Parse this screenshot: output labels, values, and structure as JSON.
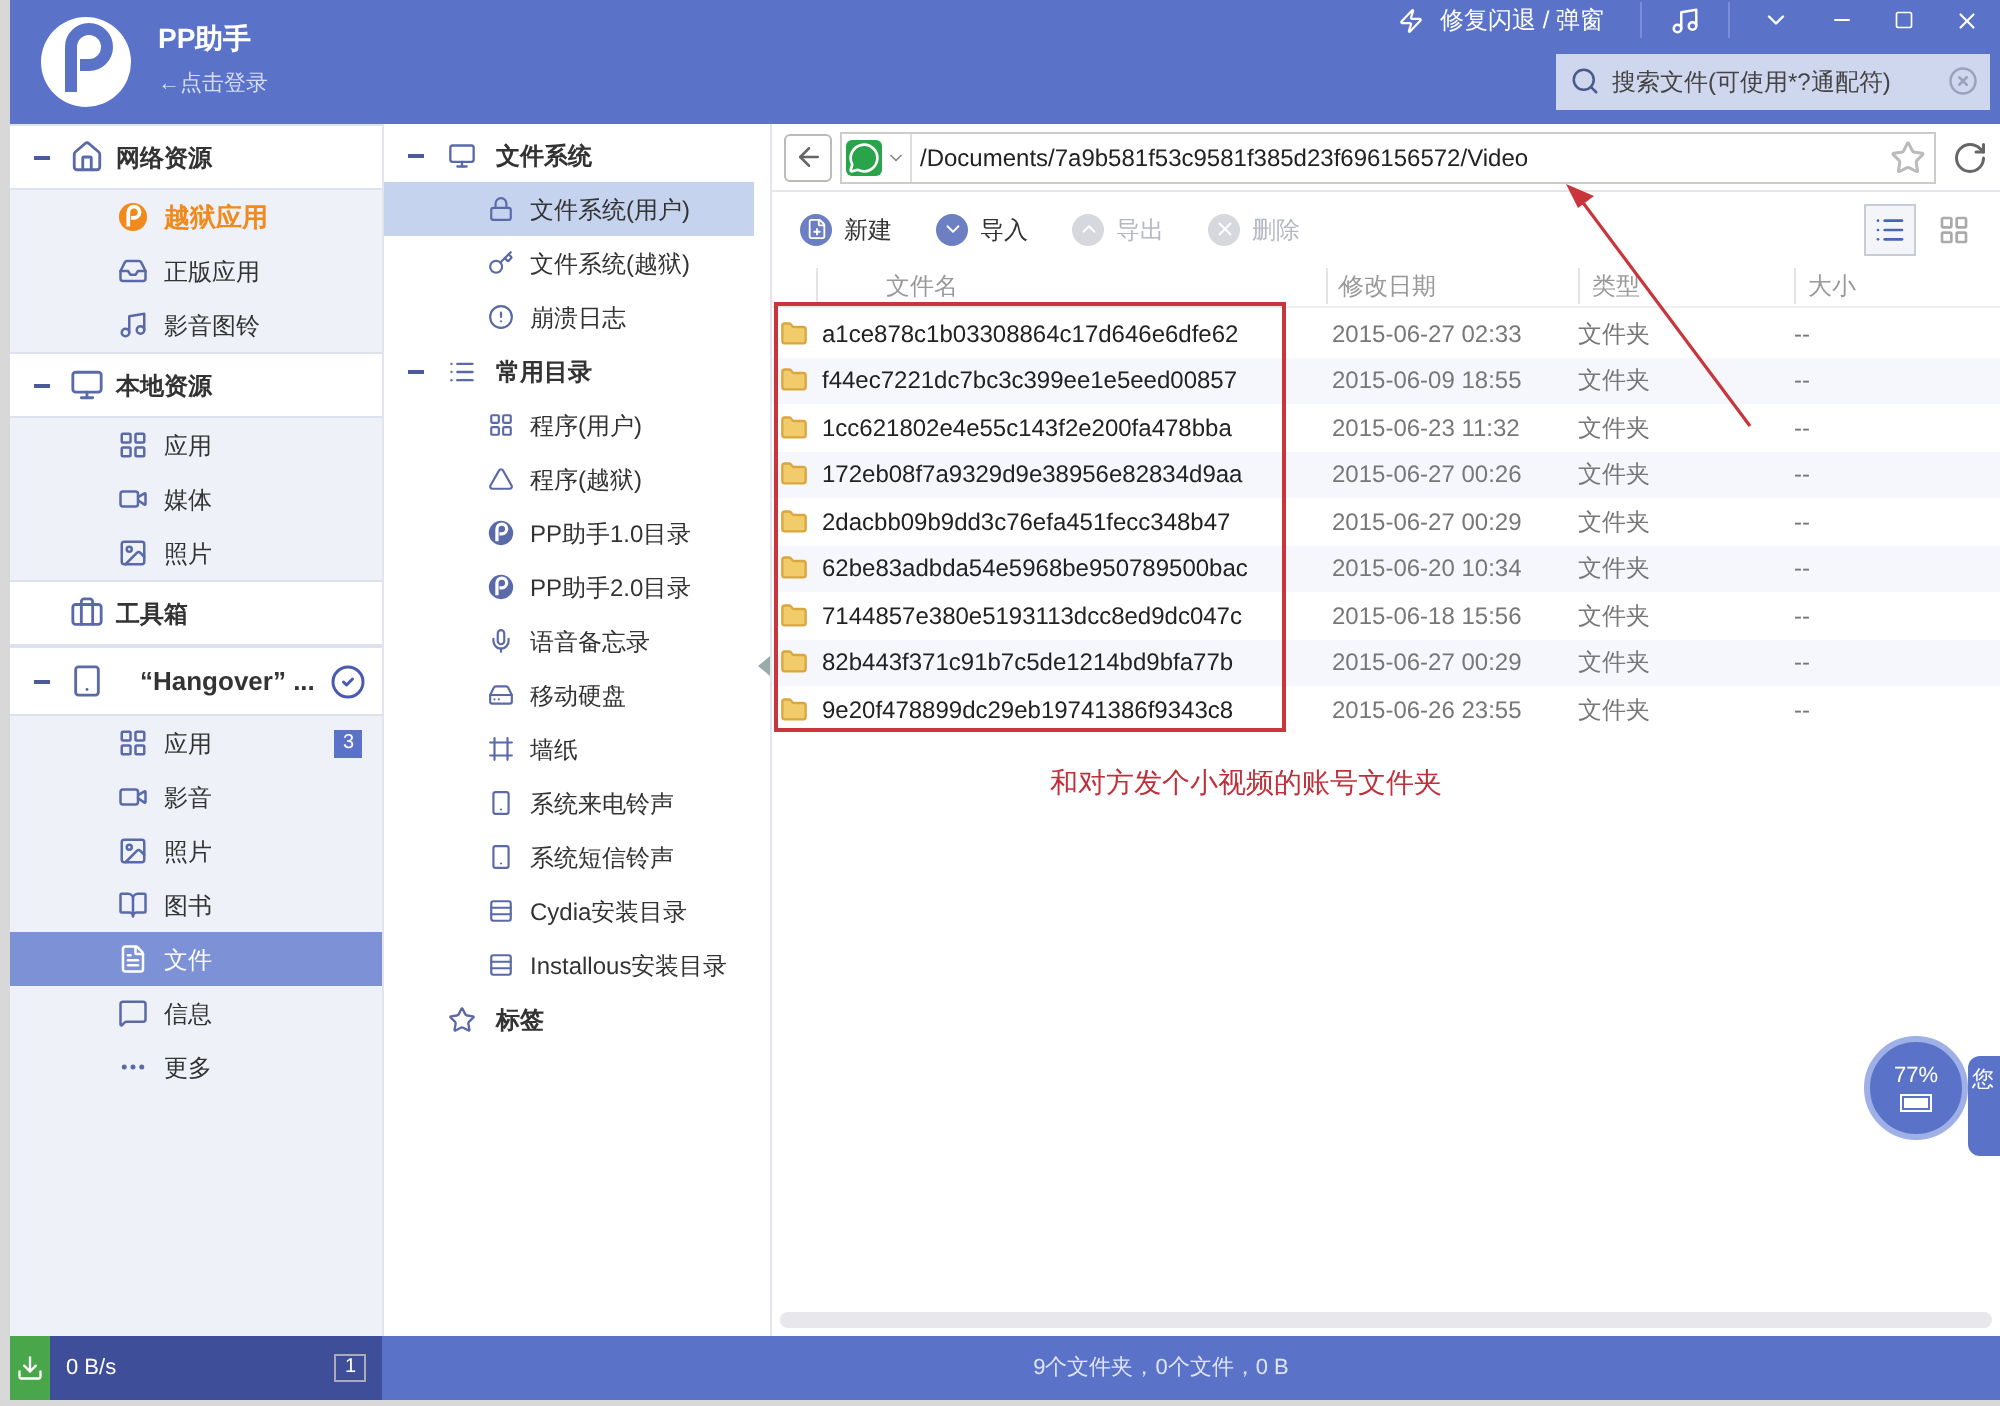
{
  "app": {
    "name": "PP助手",
    "login": "←点击登录",
    "fix_link": "修复闪退 / 弹窗",
    "search": {
      "placeholder": "搜索文件(可使用*?通配符)"
    }
  },
  "sidebar": {
    "groups": [
      {
        "label": "网络资源",
        "expanded": true,
        "children": [
          {
            "label": "越狱应用",
            "highlighted": true,
            "selected": false
          },
          {
            "label": "正版应用",
            "highlighted": false,
            "selected": false
          },
          {
            "label": "影音图铃",
            "highlighted": false,
            "selected": false
          }
        ]
      },
      {
        "label": "本地资源",
        "expanded": true,
        "children": [
          {
            "label": "应用",
            "selected": false
          },
          {
            "label": "媒体",
            "selected": false
          },
          {
            "label": "照片",
            "selected": false
          }
        ]
      },
      {
        "label": "工具箱"
      },
      {
        "label": "“Hangover” ...",
        "expanded": true,
        "connected": true,
        "children": [
          {
            "label": "应用",
            "count": "3",
            "selected": false
          },
          {
            "label": "影音",
            "selected": false
          },
          {
            "label": "照片",
            "selected": false
          },
          {
            "label": "图书",
            "selected": false
          },
          {
            "label": "文件",
            "selected": true
          },
          {
            "label": "信息",
            "selected": false
          },
          {
            "label": "更多",
            "selected": false
          }
        ]
      }
    ]
  },
  "tree": {
    "groups": [
      {
        "label": "文件系统",
        "expanded": true,
        "children": [
          {
            "label": "文件系统(用户)",
            "selected": true
          },
          {
            "label": "文件系统(越狱)",
            "selected": false
          },
          {
            "label": "崩溃日志",
            "selected": false
          }
        ]
      },
      {
        "label": "常用目录",
        "expanded": true,
        "children": [
          {
            "label": "程序(用户)",
            "selected": false
          },
          {
            "label": "程序(越狱)",
            "selected": false
          },
          {
            "label": "PP助手1.0目录",
            "selected": false
          },
          {
            "label": "PP助手2.0目录",
            "selected": false
          },
          {
            "label": "语音备忘录",
            "selected": false
          },
          {
            "label": "移动硬盘",
            "selected": false
          },
          {
            "label": "墙纸",
            "selected": false
          },
          {
            "label": "系统来电铃声",
            "selected": false
          },
          {
            "label": "系统短信铃声",
            "selected": false
          },
          {
            "label": "Cydia安装目录",
            "selected": false
          },
          {
            "label": "Installous安装目录",
            "selected": false
          }
        ]
      },
      {
        "label": "标签"
      }
    ]
  },
  "path": "/Documents/7a9b581f53c9581f385d23f696156572/Video",
  "toolbar": [
    {
      "label": "新建",
      "disabled": false
    },
    {
      "label": "导入",
      "disabled": false
    },
    {
      "label": "导出",
      "disabled": true
    },
    {
      "label": "删除",
      "disabled": true
    }
  ],
  "views": [
    {
      "kind": "list",
      "selected": true
    },
    {
      "kind": "grid",
      "selected": false
    }
  ],
  "table": {
    "columns": [
      "文件名",
      "修改日期",
      "类型",
      "大小"
    ],
    "rows": [
      [
        "a1ce878c1b03308864c17d646e6dfe62",
        "2015-06-27 02:33",
        "文件夹",
        "--"
      ],
      [
        "f44ec7221dc7bc3c399ee1e5eed00857",
        "2015-06-09 18:55",
        "文件夹",
        "--"
      ],
      [
        "1cc621802e4e55c143f2e200fa478bba",
        "2015-06-23 11:32",
        "文件夹",
        "--"
      ],
      [
        "172eb08f7a9329d9e38956e82834d9aa",
        "2015-06-27 00:26",
        "文件夹",
        "--"
      ],
      [
        "2dacbb09b9dd3c76efa451fecc348b47",
        "2015-06-27 00:29",
        "文件夹",
        "--"
      ],
      [
        "62be83adbda54e5968be950789500bac",
        "2015-06-20 10:34",
        "文件夹",
        "--"
      ],
      [
        "7144857e380e5193113dcc8ed9dc047c",
        "2015-06-18 15:56",
        "文件夹",
        "--"
      ],
      [
        "82b443f371c91b7c5de1214bd9bfa77b",
        "2015-06-27 00:29",
        "文件夹",
        "--"
      ],
      [
        "9e20f478899dc29eb19741386f9343c8",
        "2015-06-26 23:55",
        "文件夹",
        "--"
      ]
    ]
  },
  "annotation": "和对方发个小视频的账号文件夹",
  "battery": {
    "percent": "77%",
    "note": "您"
  },
  "status_bar": {
    "speed": "0 B/s",
    "tasks": "1",
    "summary": "9个文件夹，0个文件，0 B"
  }
}
